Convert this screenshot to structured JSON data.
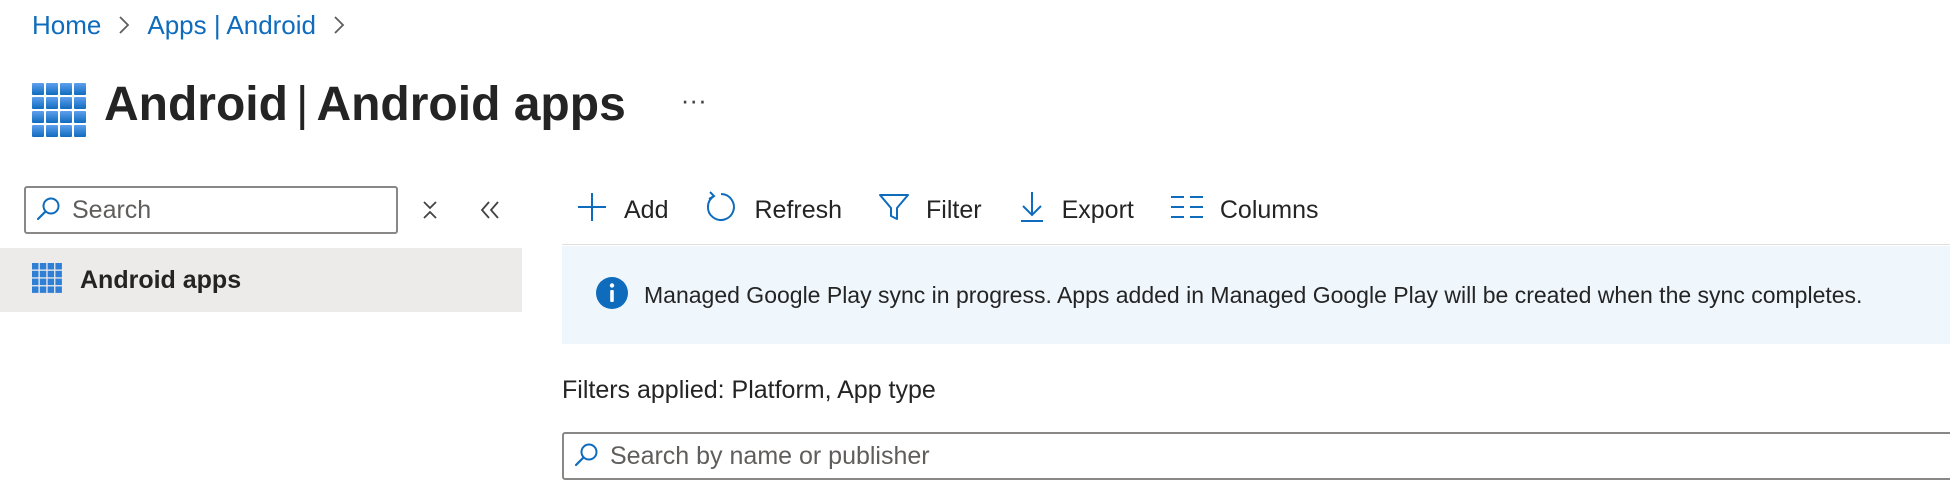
{
  "breadcrumb": {
    "items": [
      {
        "label": "Home"
      },
      {
        "label": "Apps | Android"
      }
    ]
  },
  "header": {
    "title_bold": "Android",
    "title_separator": "|",
    "title_rest": "Android apps",
    "more_label": "···"
  },
  "nav": {
    "search": {
      "placeholder": "Search",
      "value": ""
    },
    "items": [
      {
        "label": "Android apps",
        "selected": true
      }
    ]
  },
  "toolbar": {
    "add_label": "Add",
    "refresh_label": "Refresh",
    "filter_label": "Filter",
    "export_label": "Export",
    "columns_label": "Columns"
  },
  "banner": {
    "text": "Managed Google Play sync in progress. Apps added in Managed Google Play will be created when the sync completes."
  },
  "filters": {
    "text": "Filters applied: Platform, App type"
  },
  "list_search": {
    "placeholder": "Search by name or publisher",
    "value": ""
  },
  "colors": {
    "accent": "#0f6cbd",
    "selected_bg": "#edebe9",
    "banner_bg": "#eff6fc",
    "text": "#242424"
  },
  "icons": {
    "app": "grid-apps-icon",
    "search": "search-icon",
    "clear": "clear-filter-icon",
    "collapse": "double-chevron-left-icon",
    "add": "plus-icon",
    "refresh": "refresh-icon",
    "filter": "filter-funnel-icon",
    "export": "download-arrow-icon",
    "columns": "columns-icon",
    "info": "info-icon"
  }
}
